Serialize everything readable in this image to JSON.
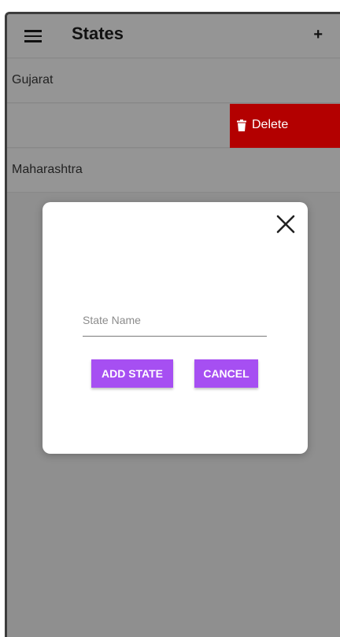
{
  "header": {
    "title": "States",
    "menu_icon": "hamburger-menu-icon",
    "add_label": "+"
  },
  "states": {
    "items": [
      {
        "label": "Gujarat"
      },
      {
        "label": ""
      },
      {
        "label": "Maharashtra"
      }
    ],
    "swipe_action": {
      "label": "Delete",
      "icon": "trash-icon",
      "color": "#b30000"
    }
  },
  "dialog": {
    "close_icon": "close-icon",
    "field": {
      "value": "",
      "placeholder": "State Name"
    },
    "add_button_label": "ADD STATE",
    "cancel_button_label": "CANCEL",
    "button_color": "#a64ff2"
  }
}
